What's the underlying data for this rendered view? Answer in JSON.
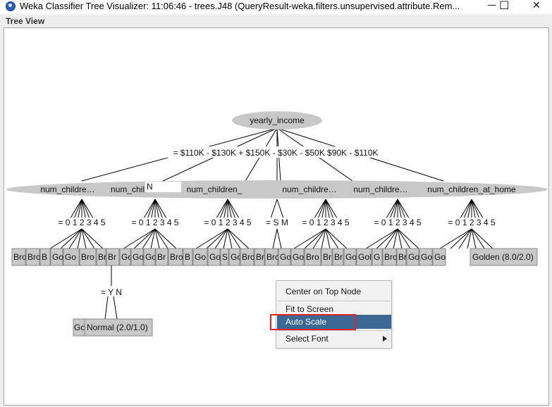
{
  "window": {
    "title": "Weka Classifier Tree Visualizer: 11:06:46 - trees.J48 (QueryResult-weka.filters.unsupervised.attribute.Rem...",
    "minimize": "—",
    "maximize": "☐",
    "close": "✕"
  },
  "panel": {
    "label": "Tree View"
  },
  "tree": {
    "root": "yearly_income",
    "root_edges": "= $110K - $130K + $150K - $30K - $50K $90K - $110K",
    "nodes": [
      "num_children_at_home",
      "num_chil",
      "num_children_at_home",
      "num_children_at_home",
      "num_children_at_home",
      "num_children_at_home"
    ],
    "node_edges": [
      "= 0 1 2 3 4 5",
      "= 0 1 2 3 4 5",
      "= 0 1 2 3 4 5",
      "= S M",
      "= 0 1 2 3 4 5",
      "= 0 1 2 3 4 5",
      "= 0 1 2 3 4 5"
    ],
    "partial_label": "N",
    "leaves_row": [
      "Bro",
      "Bro",
      "B",
      "Go",
      "Go",
      "Bro",
      "Br",
      "Br",
      "Go",
      "Go",
      "Go",
      "Br",
      "Bro",
      "B",
      "Go",
      "Go",
      "S",
      "Go",
      "Bro",
      "Br",
      "Bro",
      "Go",
      "Go",
      "Bro",
      "Br",
      "Br",
      "Go",
      "Gol",
      "G",
      "Bro",
      "Br",
      "Go",
      "Go",
      "Go"
    ],
    "last_leaf": "Golden (8.0/2.0)",
    "sub_edge": "= Y N",
    "sub_leaf_small": "Go",
    "sub_leaf": "Normal (2.0/1.0)"
  },
  "context_menu": {
    "items": [
      {
        "label": "Center on Top Node"
      },
      {
        "label": "Fit to Screen"
      },
      {
        "label": "Auto Scale"
      },
      {
        "label": "Select Font"
      }
    ],
    "selected": "Auto Scale"
  },
  "colors": {
    "node_fill": "#c8c8c8",
    "leaf_fill": "#c8c8c8",
    "menu_selected": "#3b6894",
    "highlight": "#e02424"
  }
}
